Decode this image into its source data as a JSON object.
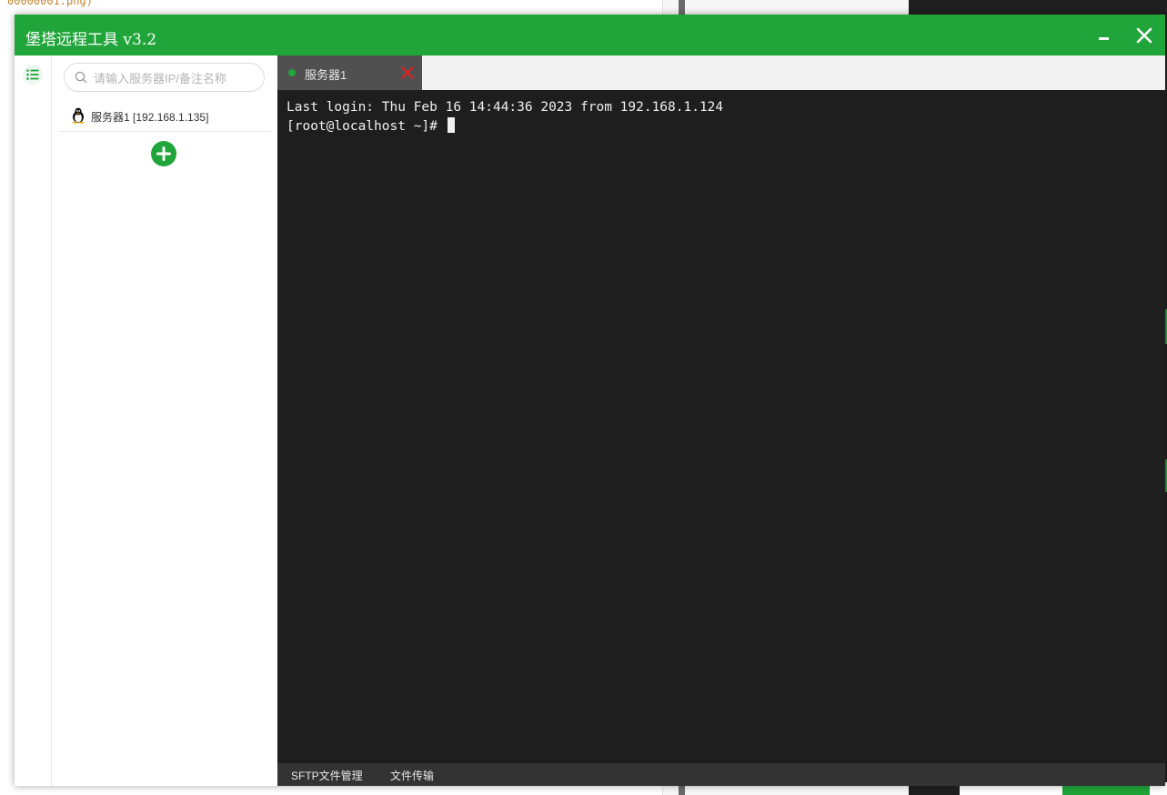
{
  "background": {
    "snippet": "00000001.png)"
  },
  "window": {
    "title": "堡塔远程工具 v3.2"
  },
  "sidebar": {
    "search_placeholder": "请输入服务器IP/备注名称",
    "servers": [
      {
        "label": "服务器1 [192.168.1.135]"
      }
    ]
  },
  "tabs": [
    {
      "label": "服务器1",
      "status": "connected"
    }
  ],
  "terminal": {
    "lines": [
      "Last login: Thu Feb 16 14:44:36 2023 from 192.168.1.124",
      "[root@localhost ~]# "
    ]
  },
  "bottom_bar": {
    "sftp_label": "SFTP文件管理",
    "transfer_label": "文件传输"
  },
  "colors": {
    "brand": "#20a53a",
    "terminal_bg": "#1e1e1e",
    "tab_close": "#e02020"
  }
}
